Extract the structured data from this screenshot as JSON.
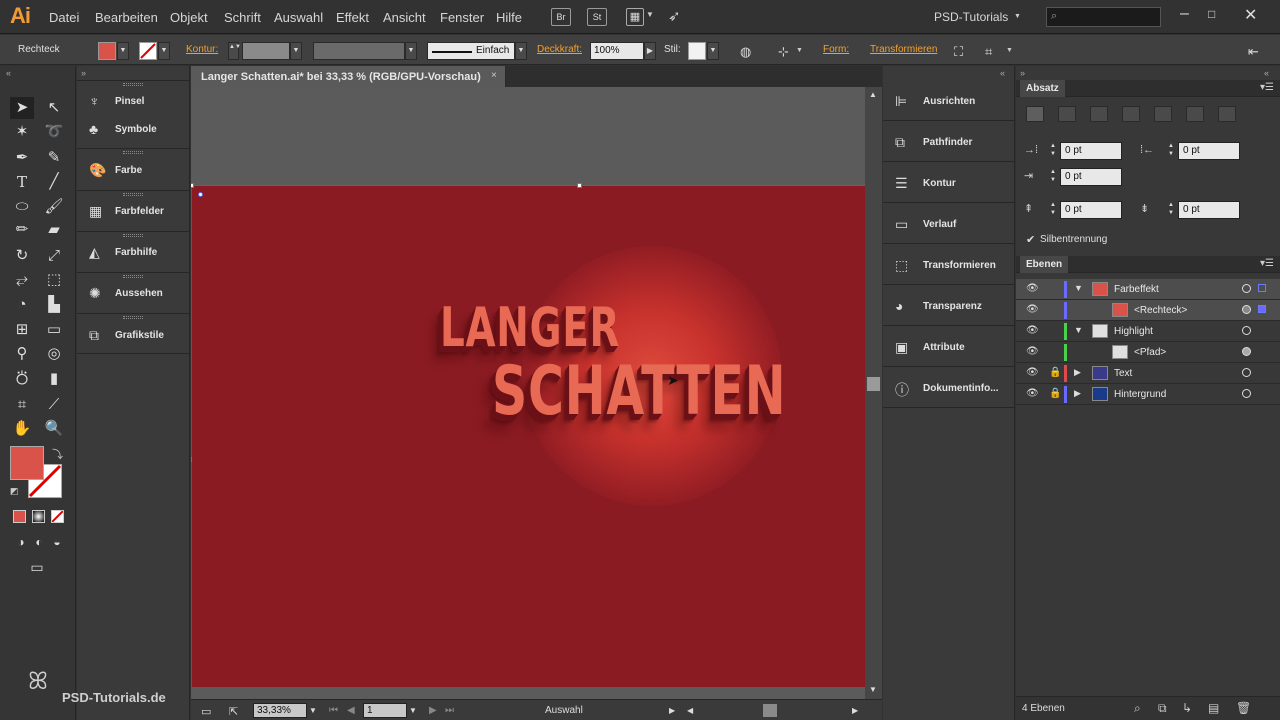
{
  "app": {
    "logo": "Ai",
    "menu": [
      "Datei",
      "Bearbeiten",
      "Objekt",
      "Schrift",
      "Auswahl",
      "Effekt",
      "Ansicht",
      "Fenster",
      "Hilfe"
    ],
    "bridge_buttons": [
      "Br",
      "St"
    ],
    "workspace": "PSD-Tutorials",
    "window_controls": [
      "minimize-icon",
      "maximize-icon",
      "close-icon"
    ]
  },
  "control_bar": {
    "selection_type": "Rechteck",
    "fill_color": "#d9534a",
    "stroke_label": "Kontur:",
    "stroke_profile": "Einfach",
    "opacity_label": "Deckkraft:",
    "opacity_value": "100%",
    "style_label": "Stil:",
    "shape_label": "Form:",
    "transform_label": "Transformieren"
  },
  "document": {
    "tab_title": "Langer Schatten.ai* bei 33,33 % (RGB/GPU-Vorschau)",
    "tab_close": "×",
    "artboard_color": "#8a1b22",
    "art_line1": "LANGER",
    "art_line2": "SCHATTEN",
    "text_color": "#e86a55",
    "zoom": "33,33%",
    "artboard_number": "1",
    "status_tool": "Auswahl"
  },
  "tools_panel": {
    "fill_color": "#d9534a",
    "stroke_color": "#ffffff"
  },
  "icon_panels": [
    {
      "icon": "brush-icon",
      "label": "Pinsel"
    },
    {
      "icon": "symbols-icon",
      "label": "Symbole"
    },
    {
      "icon": "color-palette-icon",
      "label": "Farbe"
    },
    {
      "icon": "swatches-icon",
      "label": "Farbfelder"
    },
    {
      "icon": "color-guide-icon",
      "label": "Farbhilfe"
    },
    {
      "icon": "appearance-icon",
      "label": "Aussehen"
    },
    {
      "icon": "graphic-styles-icon",
      "label": "Grafikstile"
    }
  ],
  "mid_panels": [
    {
      "icon": "align-icon",
      "label": "Ausrichten"
    },
    {
      "icon": "pathfinder-icon",
      "label": "Pathfinder"
    },
    {
      "icon": "stroke-icon",
      "label": "Kontur"
    },
    {
      "icon": "gradient-icon",
      "label": "Verlauf"
    },
    {
      "icon": "transform-icon",
      "label": "Transformieren"
    },
    {
      "icon": "transparency-icon",
      "label": "Transparenz"
    },
    {
      "icon": "attributes-icon",
      "label": "Attribute"
    },
    {
      "icon": "document-info-icon",
      "label": "Dokumentinfo..."
    }
  ],
  "paragraph_panel": {
    "title": "Absatz",
    "left_indent": "0 pt",
    "right_indent": "0 pt",
    "first_line_indent": "0 pt",
    "space_before": "0 pt",
    "space_after": "0 pt",
    "hyphenation_label": "Silbentrennung",
    "hyphenation_checked": true
  },
  "layers_panel": {
    "title": "Ebenen",
    "layers": [
      {
        "name": "Farbeffekt",
        "color": "#6a6aff",
        "thumb": "#d9534a",
        "level": 0,
        "expanded": true,
        "locked": false,
        "selected": true
      },
      {
        "name": "<Rechteck>",
        "color": "#6a6aff",
        "thumb": "#d9534a",
        "level": 1,
        "expanded": false,
        "locked": false,
        "selected": true
      },
      {
        "name": "Highlight",
        "color": "#4ad04a",
        "thumb": "#e0e0e0",
        "level": 0,
        "expanded": true,
        "locked": false,
        "selected": false
      },
      {
        "name": "<Pfad>",
        "color": "#4ad04a",
        "thumb": "#e0e0e0",
        "level": 1,
        "expanded": false,
        "locked": false,
        "selected": false
      },
      {
        "name": "Text",
        "color": "#e04a4a",
        "thumb": "#3a3a8a",
        "level": 0,
        "expanded": false,
        "locked": true,
        "selected": false
      },
      {
        "name": "Hintergrund",
        "color": "#6a6aff",
        "thumb": "#1a3a8a",
        "level": 0,
        "expanded": false,
        "locked": true,
        "selected": false
      }
    ],
    "count": "4 Ebenen"
  },
  "watermark": "PSD-Tutorials.de"
}
